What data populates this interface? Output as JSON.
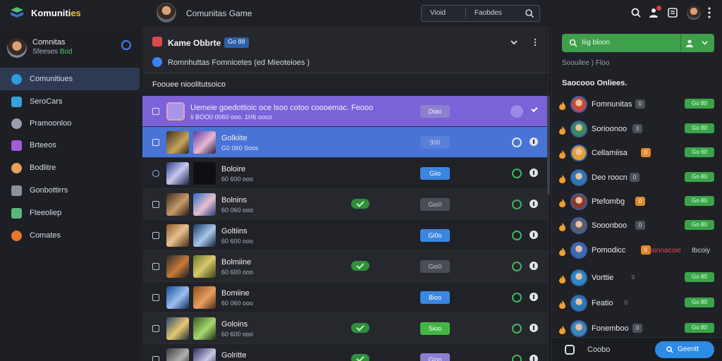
{
  "app": {
    "title_main": "Komuniti",
    "title_suffix": "es",
    "game_title": "Comunitas Game"
  },
  "segment": {
    "left": "Vioid",
    "right": "Faobdes",
    "icon": "search-icon"
  },
  "top_icons": [
    "search-icon",
    "notification-icon",
    "chat-icon",
    "avatar",
    "more-icon"
  ],
  "user": {
    "name": "Comnitas",
    "sub": "Sfeeses",
    "status": "Bod"
  },
  "nav": [
    {
      "label": "Comunitiues",
      "color": "#2f9be0",
      "icon": "community-icon"
    },
    {
      "label": "SeroCars",
      "color": "#3aa0d8",
      "icon": "servers-icon"
    },
    {
      "label": "Pramoonloo",
      "color": "#9aa0ab",
      "icon": "promotion-icon"
    },
    {
      "label": "Brteeos",
      "color": "#a25cd6",
      "icon": "streams-icon"
    },
    {
      "label": "Bodlitre",
      "color": "#e7a15c",
      "icon": "profile-icon"
    },
    {
      "label": "Gonbottirrs",
      "color": "#8c929c",
      "icon": "controller-icon"
    },
    {
      "label": "Fteeoliep",
      "color": "#58b87c",
      "icon": "photo-icon"
    },
    {
      "label": "Comates",
      "color": "#e8762c",
      "icon": "friends-icon"
    }
  ],
  "center": {
    "title": "Kame Obbrte",
    "badge": "Go 88",
    "subtitle": "Romnhuttas Fomnicetes (ed Mieoteioes )",
    "section": "Foouee nioolitutsoico",
    "rows": [
      {
        "type": "purple",
        "title": "Uemeie goedottioic oce lsoo cotoo coooemac. Feooo",
        "meta": "Ii BOO0 0060 ooo. 1H6 ooco",
        "pill": "Diao",
        "pill_style": "soft"
      },
      {
        "type": "blue",
        "name": "Golkiite",
        "meta": "G0 060 Soos",
        "pill": "900",
        "pill_style": "ghost"
      },
      {
        "type": "dark",
        "name": "Boloire",
        "meta": "60 600 ooo",
        "pill": "Giio",
        "pill_style": "blue"
      },
      {
        "type": "alt",
        "name": "Bolnins",
        "meta": "60 060 ooo",
        "check": true,
        "pill": "Gio0",
        "pill_style": "grey"
      },
      {
        "type": "dark",
        "name": "Goltiins",
        "meta": "60 600 ooo",
        "pill": "Gi0o",
        "pill_style": "blue"
      },
      {
        "type": "alt",
        "name": "Bolmiine",
        "meta": "60 600 ooo",
        "check": true,
        "pill": "Gio0",
        "pill_style": "grey"
      },
      {
        "type": "dark",
        "name": "Bomiine",
        "meta": "60 060 ooo",
        "pill": "Bioo",
        "pill_style": "blue"
      },
      {
        "type": "alt",
        "name": "Goloins",
        "meta": "60 600 ooo",
        "check": true,
        "pill": "Sioo",
        "pill_style": "green"
      },
      {
        "type": "dark",
        "name": "Golritte",
        "meta": "",
        "check": true,
        "pill": "Gioo",
        "pill_style": "soft"
      }
    ]
  },
  "right": {
    "search": "Iiig bloon",
    "breadcrumb": "Soouilee ) Floo",
    "section": "Saocooo Onliees.",
    "friends": [
      {
        "name": "Fomnunitas",
        "tag": "0",
        "tag_style": "grey",
        "btn": "Go 80"
      },
      {
        "name": "Sorioonoo",
        "tag": "3",
        "tag_style": "grey",
        "btn": "Go 80"
      },
      {
        "name": "Cellamiisa",
        "tag": "0",
        "tag_style": "orange",
        "btn": "Go 60"
      },
      {
        "name": "Deo roocn",
        "tag": "0",
        "tag_style": "grey",
        "btn": "Go 80"
      },
      {
        "name": "Ptefombg",
        "tag": "0",
        "tag_style": "orange",
        "btn": "Go 80"
      },
      {
        "name": "Sooonboo",
        "tag": "0",
        "tag_style": "grey",
        "btn": "Go 80"
      },
      {
        "name": "Pomodicc",
        "tag": "0",
        "tag_style": "orange",
        "warn": "Ioonnacoie",
        "warn2": "Ibcoiy"
      },
      {
        "name": "Vorttie",
        "tag": "0",
        "tag_style": "none",
        "btn": "Go 80"
      },
      {
        "name": "Featio",
        "tag": "0",
        "tag_style": "none",
        "btn": "Go 80"
      },
      {
        "name": "Fonemboo",
        "tag": "0",
        "tag_style": "grey",
        "btn": "Go 80"
      }
    ],
    "footer_label": "Coobo",
    "footer_button": "Geentt"
  },
  "colors": {
    "accent_green": "#3ea04a",
    "accent_blue": "#2e8be6",
    "purple_row": "#7b62d8",
    "blue_row": "#4a73d6"
  }
}
